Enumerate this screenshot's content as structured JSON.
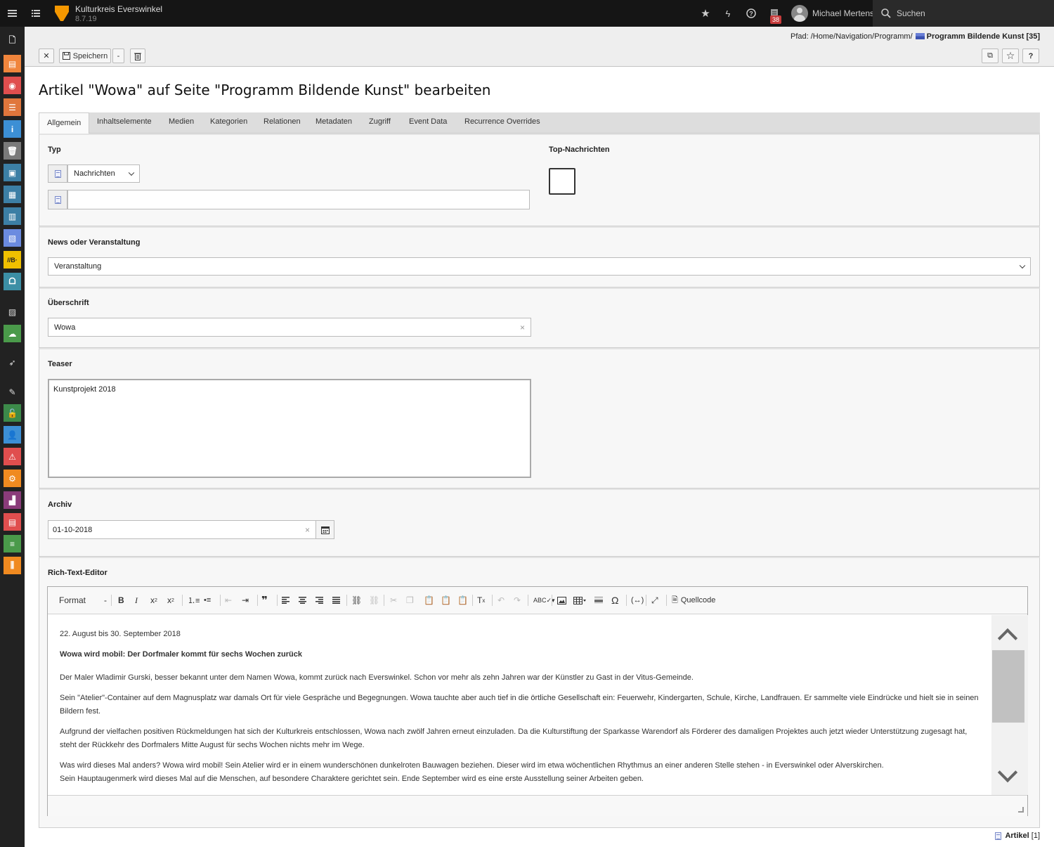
{
  "topbar": {
    "site_name": "Kulturkreis Everswinkel",
    "version": "8.7.19",
    "notification_count": "38",
    "user_name": "Michael Mertens",
    "search_label": "Suchen"
  },
  "docheader": {
    "path_prefix": "Pfad: /Home/Navigation/Programm/",
    "path_current": "Programm Bildende Kunst [35]",
    "save_label": "Speichern",
    "dropdown_label": "-",
    "help_label": "?"
  },
  "page_title": "Artikel \"Wowa\" auf Seite \"Programm Bildende Kunst\" bearbeiten",
  "tabs": [
    "Allgemein",
    "Inhaltselemente",
    "Medien",
    "Kategorien",
    "Relationen",
    "Metadaten",
    "Zugriff",
    "Event Data",
    "Recurrence Overrides"
  ],
  "form": {
    "typ_label": "Typ",
    "typ_value": "Nachrichten",
    "typ_extra_value": "",
    "top_label": "Top-Nachrichten",
    "news_label": "News oder Veranstaltung",
    "news_value": "Veranstaltung",
    "headline_label": "Überschrift",
    "headline_value": "Wowa",
    "teaser_label": "Teaser",
    "teaser_value": "Kunstprojekt 2018",
    "archive_label": "Archiv",
    "archive_value": "01-10-2018",
    "rte_label": "Rich-Text-Editor"
  },
  "rte": {
    "format_label": "Format",
    "format_arrow": "-",
    "source_label": "Quellcode",
    "content": {
      "date_line": "22. August bis 30. September 2018",
      "heading": "Wowa wird mobil: Der Dorfmaler kommt für sechs Wochen zurück",
      "p1": "Der Maler Wladimir Gurski, besser bekannt unter dem Namen Wowa, kommt zurück nach Everswinkel. Schon vor mehr als zehn Jahren war der Künstler zu Gast in der Vitus-Gemeinde.",
      "p2": "Sein \"Atelier\"-Container auf dem Magnusplatz war damals Ort für viele Gespräche und Begegnungen. Wowa tauchte aber auch tief in die örtliche Gesellschaft ein: Feuerwehr, Kindergarten, Schule, Kirche, Landfrauen. Er sammelte viele Eindrücke und hielt sie in seinen Bildern fest.",
      "p3": "Aufgrund der vielfachen positiven Rückmeldungen hat sich der Kulturkreis entschlossen, Wowa nach zwölf Jahren erneut einzuladen. Da die Kulturstiftung der Sparkasse Warendorf als Förderer des damaligen Projektes auch jetzt wieder Unterstützung zugesagt hat, steht der Rückkehr des Dorfmalers Mitte August für sechs Wochen nichts mehr im Wege.",
      "p4a": "Was wird dieses Mal anders? Wowa wird mobil! Sein Atelier wird er in einem wunderschönen dunkelroten Bauwagen beziehen. Dieser wird im etwa wöchentlichen Rhythmus an einer anderen Stelle stehen - in Everswinkel oder Alverskirchen.",
      "p4b": "Sein Hauptaugenmerk wird dieses Mal auf die Menschen, auf besondere Charaktere gerichtet sein. Ende September wird es eine erste Ausstellung seiner Arbeiten geben."
    }
  },
  "footer": {
    "record_type": "Artikel",
    "record_id": "[1]"
  },
  "colors": {
    "topbar_bg": "#151515",
    "sidebar_bg": "#222222",
    "brand_orange": "#f49700",
    "badge_red": "#c83c3c"
  },
  "sidebar_modules": [
    {
      "name": "page-module",
      "color": "#222222"
    },
    {
      "name": "view-module",
      "color": "#f0853c"
    },
    {
      "name": "preview-module",
      "color": "#e04e4e"
    },
    {
      "name": "list-module",
      "color": "#e0763c"
    },
    {
      "name": "info-module",
      "color": "#3c8fd5"
    },
    {
      "name": "recycler-module",
      "color": "#7a7a7a"
    },
    {
      "name": "toolbox-module",
      "color": "#3c7fa5"
    },
    {
      "name": "forms-module",
      "color": "#3c7fa5"
    },
    {
      "name": "layout-module",
      "color": "#3c7fa5"
    },
    {
      "name": "news-module",
      "color": "#6b8be0"
    },
    {
      "name": "b-module",
      "color": "#f0c000"
    },
    {
      "name": "binoculars-module",
      "color": "#3c8fa5"
    },
    {
      "name": "filelist-module",
      "color": "#222222"
    },
    {
      "name": "cloud-module",
      "color": "#4a9a4a"
    },
    {
      "name": "rocket-module",
      "color": "#222222"
    },
    {
      "name": "plugin-module",
      "color": "#222222"
    },
    {
      "name": "access-module",
      "color": "#3c8a4a"
    },
    {
      "name": "user-module",
      "color": "#3c8fd5"
    },
    {
      "name": "reports-module",
      "color": "#e04e4e"
    },
    {
      "name": "settings-module",
      "color": "#f08a20"
    },
    {
      "name": "charts-module",
      "color": "#8a3c7a"
    },
    {
      "name": "clipboard-module",
      "color": "#e04e4e"
    },
    {
      "name": "db-module",
      "color": "#4a9a4a"
    },
    {
      "name": "sliders-module",
      "color": "#f08a20"
    }
  ]
}
